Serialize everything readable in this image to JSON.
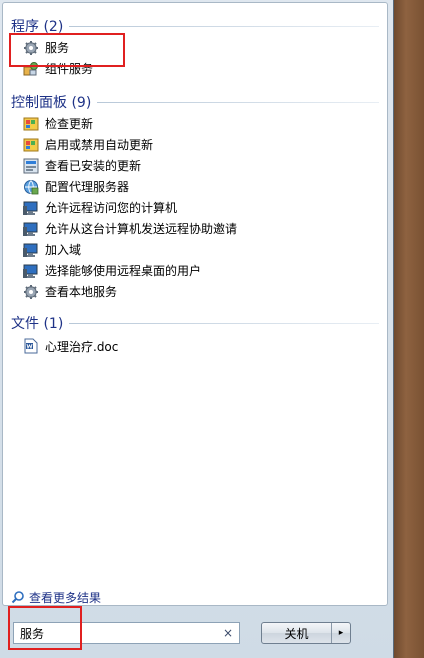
{
  "groups": {
    "programs": {
      "title": "程序 (2)",
      "items": [
        {
          "label": "服务"
        },
        {
          "label": "组件服务"
        }
      ]
    },
    "control_panel": {
      "title": "控制面板 (9)",
      "items": [
        {
          "label": "检查更新"
        },
        {
          "label": "启用或禁用自动更新"
        },
        {
          "label": "查看已安装的更新"
        },
        {
          "label": "配置代理服务器"
        },
        {
          "label": "允许远程访问您的计算机"
        },
        {
          "label": "允许从这台计算机发送远程协助邀请"
        },
        {
          "label": "加入域"
        },
        {
          "label": "选择能够使用远程桌面的用户"
        },
        {
          "label": "查看本地服务"
        }
      ]
    },
    "files": {
      "title": "文件 (1)",
      "items": [
        {
          "label": "心理治疗.doc"
        }
      ]
    }
  },
  "see_more": {
    "label": "查看更多结果"
  },
  "search": {
    "value": "服务",
    "clear_symbol": "×"
  },
  "shutdown": {
    "label": "关机",
    "arrow": "▸"
  },
  "colors": {
    "group_header": "#1e3287",
    "highlight": "#e02020"
  }
}
